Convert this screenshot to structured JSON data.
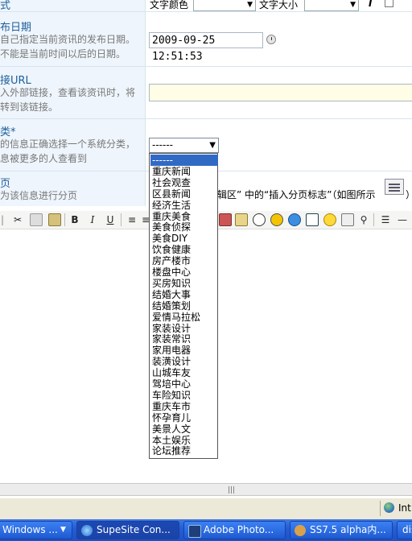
{
  "top_row": {
    "partial_label": "式",
    "text_color_label": "文字颜色",
    "text_size_label": "文字大小",
    "bold_label": "I"
  },
  "fields": {
    "publish_date": {
      "title": "布日期",
      "desc_line1": "自己指定当前资讯的发布日期。",
      "desc_line2": "不能是当前时间以后的日期。",
      "value": "2009-09-25 12:51:53"
    },
    "external_url": {
      "title": "接URL",
      "desc_line1": "入外部链接，查看该资讯时，将",
      "desc_line2": "转到该链接。",
      "value": ""
    },
    "category": {
      "title": "类*",
      "desc_line1": "的信息正确选择一个系统分类，",
      "desc_line2": "息被更多的人查看到",
      "selected": "------"
    },
    "paging": {
      "title": "页",
      "desc_line1": "为该信息进行分页",
      "hint": "辑区” 中的“插入分页标志”（如图所示",
      "hint_tail": "）"
    }
  },
  "dropdown_options": [
    "------",
    "重庆新闻",
    "社会观查",
    "区县新闻",
    "经济生活",
    "重庆美食",
    "美食侦探",
    "美食DIY",
    "饮食健康",
    "房产楼市",
    "楼盘中心",
    "买房知识",
    "结婚大事",
    "结婚策划",
    "爱情马拉松",
    "家装设计",
    "家装常识",
    "家用电器",
    "装潢设计",
    "山城车友",
    "驾培中心",
    "车险知识",
    "重庆车市",
    "怀孕育儿",
    "美景人文",
    "本土娱乐",
    "论坛推荐"
  ],
  "editor_side_text": " ",
  "toolbar": {
    "bold": "B",
    "italic": "I",
    "underline": "U"
  },
  "statusbar": {
    "zone_text": "Int"
  },
  "taskbar": {
    "items": [
      "Windows ...",
      "SupeSite Con...",
      "Adobe Photo...",
      "SS7.5 alpha内...",
      "dis"
    ]
  },
  "colors": {
    "label_title": "#1f5e9a",
    "label_bg": "#eef5fc",
    "selected_option_bg": "#316ac5",
    "taskbar_bg": "#245ed6"
  }
}
